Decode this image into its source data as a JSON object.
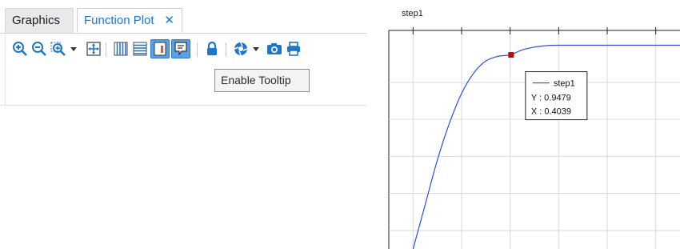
{
  "tabs": [
    {
      "label": "Graphics",
      "active": false
    },
    {
      "label": "Function Plot",
      "active": true,
      "close_glyph": "✕"
    }
  ],
  "toolbar": {
    "buttons": [
      {
        "icon": "zoom-in-icon"
      },
      {
        "icon": "zoom-out-icon"
      },
      {
        "icon": "zoom-box-icon",
        "dropdown": true
      },
      {
        "icon": "zoom-extents-icon"
      },
      {
        "icon": "x-grid-icon"
      },
      {
        "icon": "y-grid-icon"
      },
      {
        "icon": "legend-icon",
        "active": true
      },
      {
        "icon": "tooltip-icon",
        "active": true
      },
      {
        "icon": "lock-icon"
      },
      {
        "icon": "color-scheme-icon",
        "dropdown": true
      },
      {
        "icon": "camera-icon"
      },
      {
        "icon": "print-icon"
      }
    ],
    "tooltip_text": "Enable Tooltip"
  },
  "colors": {
    "accent": "#1f76c9",
    "curve": "#2f4fd8",
    "marker": "#cc0000",
    "grid": "#d9d9d9"
  },
  "chart_data": {
    "type": "line",
    "title": "step1",
    "grid": true,
    "xlim": [
      -0.1,
      1.1
    ],
    "ylim": [
      -0.1,
      1.08
    ],
    "series": [
      {
        "name": "step1",
        "x": [
          0.0,
          0.05,
          0.1,
          0.15,
          0.2,
          0.25,
          0.3,
          0.35,
          0.4,
          0.45,
          0.5,
          0.55,
          0.6,
          0.7,
          0.8,
          1.0,
          1.1
        ],
        "y": [
          -0.1,
          0.14,
          0.38,
          0.58,
          0.74,
          0.85,
          0.915,
          0.94,
          0.9479,
          0.975,
          0.99,
          0.998,
          1.0,
          1.0,
          1.0,
          1.0,
          1.0
        ]
      }
    ],
    "marker_point": {
      "x": 0.4039,
      "y": 0.9479
    },
    "data_tooltip": {
      "series_name": "step1",
      "y_text": "Y : 0.9479",
      "x_text": "X : 0.4039"
    }
  }
}
